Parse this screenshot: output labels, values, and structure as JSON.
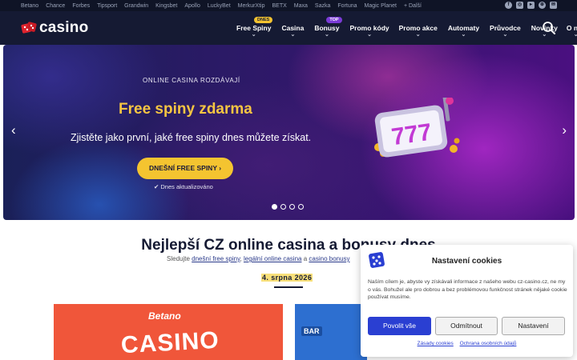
{
  "topbar": {
    "links": [
      "Betano",
      "Chance",
      "Forbes",
      "Tipsport",
      "Grandwin",
      "Kingsbet",
      "Apollo",
      "LuckyBet",
      "MerkurXtip",
      "BETX",
      "Maxa",
      "Sazka",
      "Fortuna",
      "Magic Planet",
      "+ Další"
    ],
    "social_icons": [
      "facebook-icon",
      "instagram-icon",
      "youtube-icon",
      "globe-icon",
      "mail-icon"
    ]
  },
  "header": {
    "logo_text": "casino",
    "nav": [
      {
        "label": "Free Spiny",
        "badge": "DNES"
      },
      {
        "label": "Casina"
      },
      {
        "label": "Bonusy",
        "badge": "TOP"
      },
      {
        "label": "Promo kódy"
      },
      {
        "label": "Promo akce"
      },
      {
        "label": "Automaty"
      },
      {
        "label": "Průvodce"
      },
      {
        "label": "Novinky"
      },
      {
        "label": "O nás"
      }
    ],
    "chevron": "⌄"
  },
  "hero": {
    "eyebrow": "ONLINE CASINA ROZDÁVAJÍ",
    "title": "Free spiny zdarma",
    "subtitle": "Zjistěte jako první, jaké free spiny dnes můžete získat.",
    "cta": "DNEŠNÍ FREE SPINY ›",
    "updated": "✔ Dnes aktualizováno",
    "slot_digits": "777",
    "prev_arrow": "‹",
    "next_arrow": "›",
    "slides_total": 4,
    "active_slide": 1
  },
  "main": {
    "heading": "Nejlepší CZ online casina a bonusy dnes",
    "lead_prefix": "Sledujte",
    "lead_link1": "dnešní free spiny",
    "lead_sep1": ",",
    "lead_link2": "legální online casina",
    "lead_sep2": "a",
    "lead_link3": "casino bonusy",
    "date": "4. srpna 2026"
  },
  "cards": {
    "betano_brand": "Betano",
    "betano_big": "CASINO",
    "bar_label": "BAR"
  },
  "cookies": {
    "title": "Nastavení cookies",
    "text": "Naším cílem je, abyste vy získávali informace z našeho webu cz-casino.cz, ne my o vás. Bohužel ale pro dobrou a bez problémovou funkčnost stránek nějaké cookie používat musíme.",
    "accept": "Povolit vše",
    "reject": "Odmítnout",
    "preferences": "Nastavení",
    "policy_link": "Zásady cookies",
    "privacy_link": "Ochrana osobních údajů"
  },
  "colors": {
    "header_bg": "#151a33",
    "accent_yellow": "#f4c430",
    "cookie_primary": "#2a3fd2",
    "betano_orange": "#f0563a"
  }
}
